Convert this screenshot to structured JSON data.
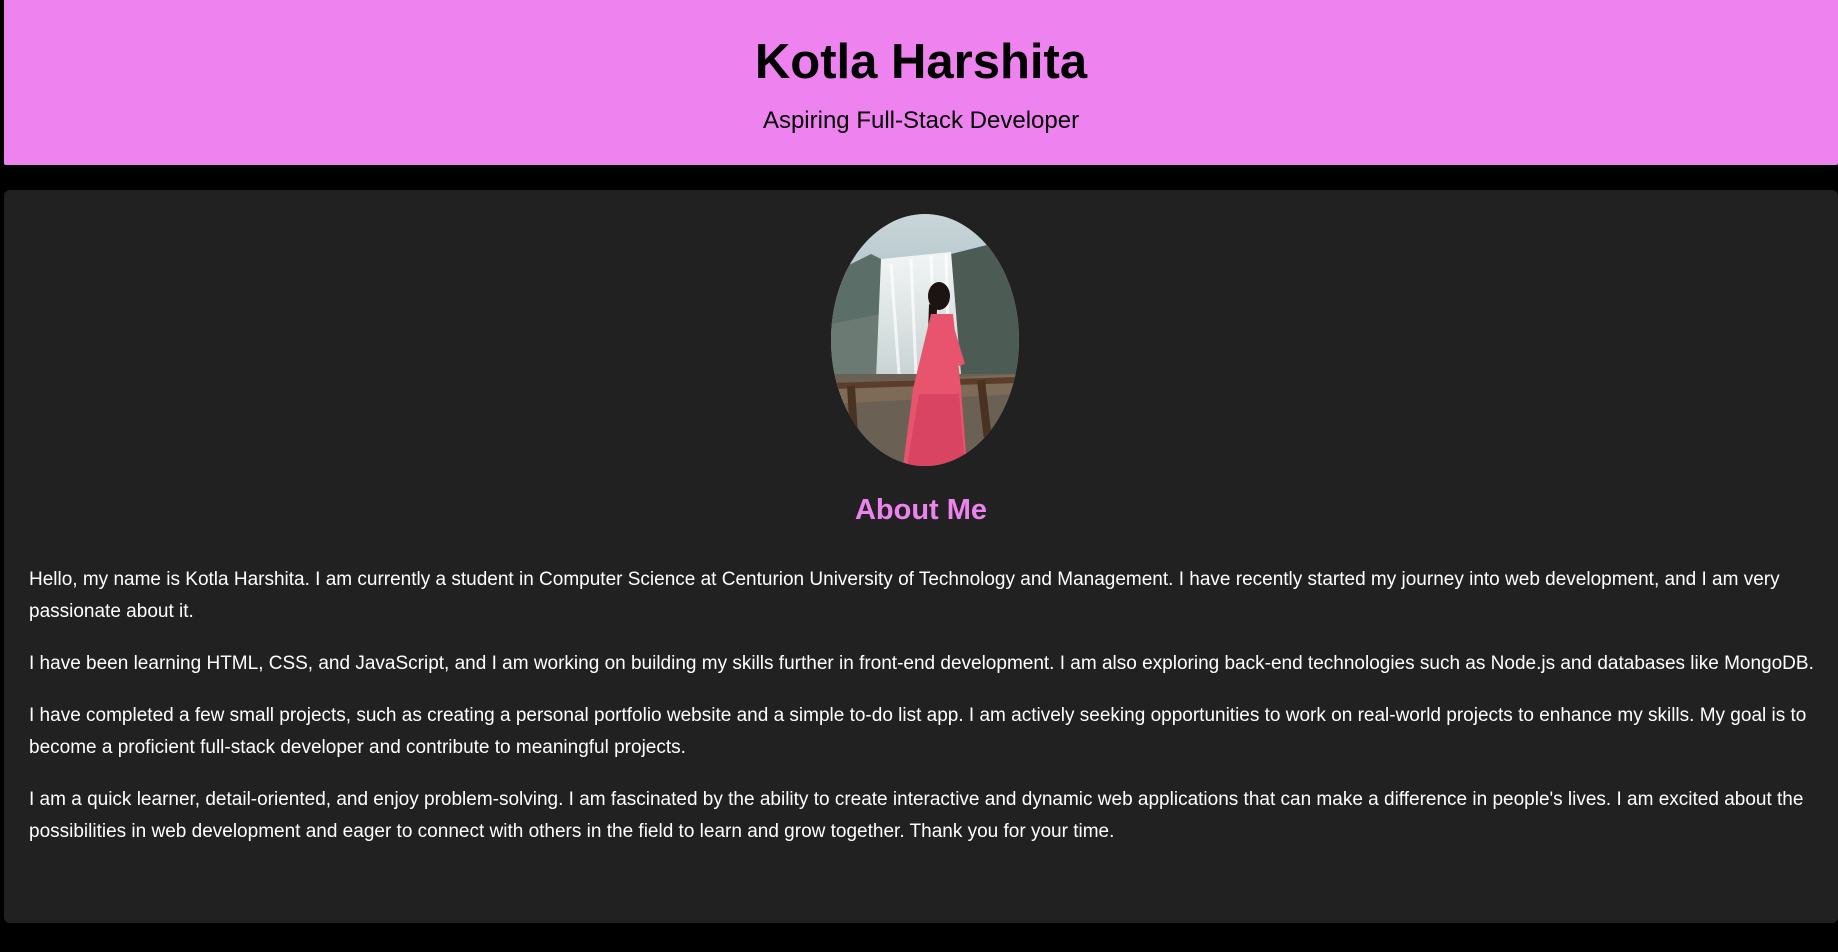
{
  "header": {
    "name": "Kotla Harshita",
    "tagline": "Aspiring Full-Stack Developer"
  },
  "about": {
    "heading": "About Me",
    "paragraphs": [
      "Hello, my name is Kotla Harshita. I am currently a student in Computer Science at Centurion University of Technology and Management. I have recently started my journey into web development, and I am very passionate about it.",
      "I have been learning HTML, CSS, and JavaScript, and I am working on building my skills further in front-end development. I am also exploring back-end technologies such as Node.js and databases like MongoDB.",
      "I have completed a few small projects, such as creating a personal portfolio website and a simple to-do list app. I am actively seeking opportunities to work on real-world projects to enhance my skills. My goal is to become a proficient full-stack developer and contribute to meaningful projects.",
      "I am a quick learner, detail-oriented, and enjoy problem-solving. I am fascinated by the ability to create interactive and dynamic web applications that can make a difference in people's lives. I am excited about the possibilities in web development and eager to connect with others in the field to learn and grow together. Thank you for your time."
    ]
  },
  "colors": {
    "header_bg": "#ee82ee",
    "heading_accent": "#ee82ee",
    "card_bg": "#212121",
    "page_bg": "#000000"
  }
}
